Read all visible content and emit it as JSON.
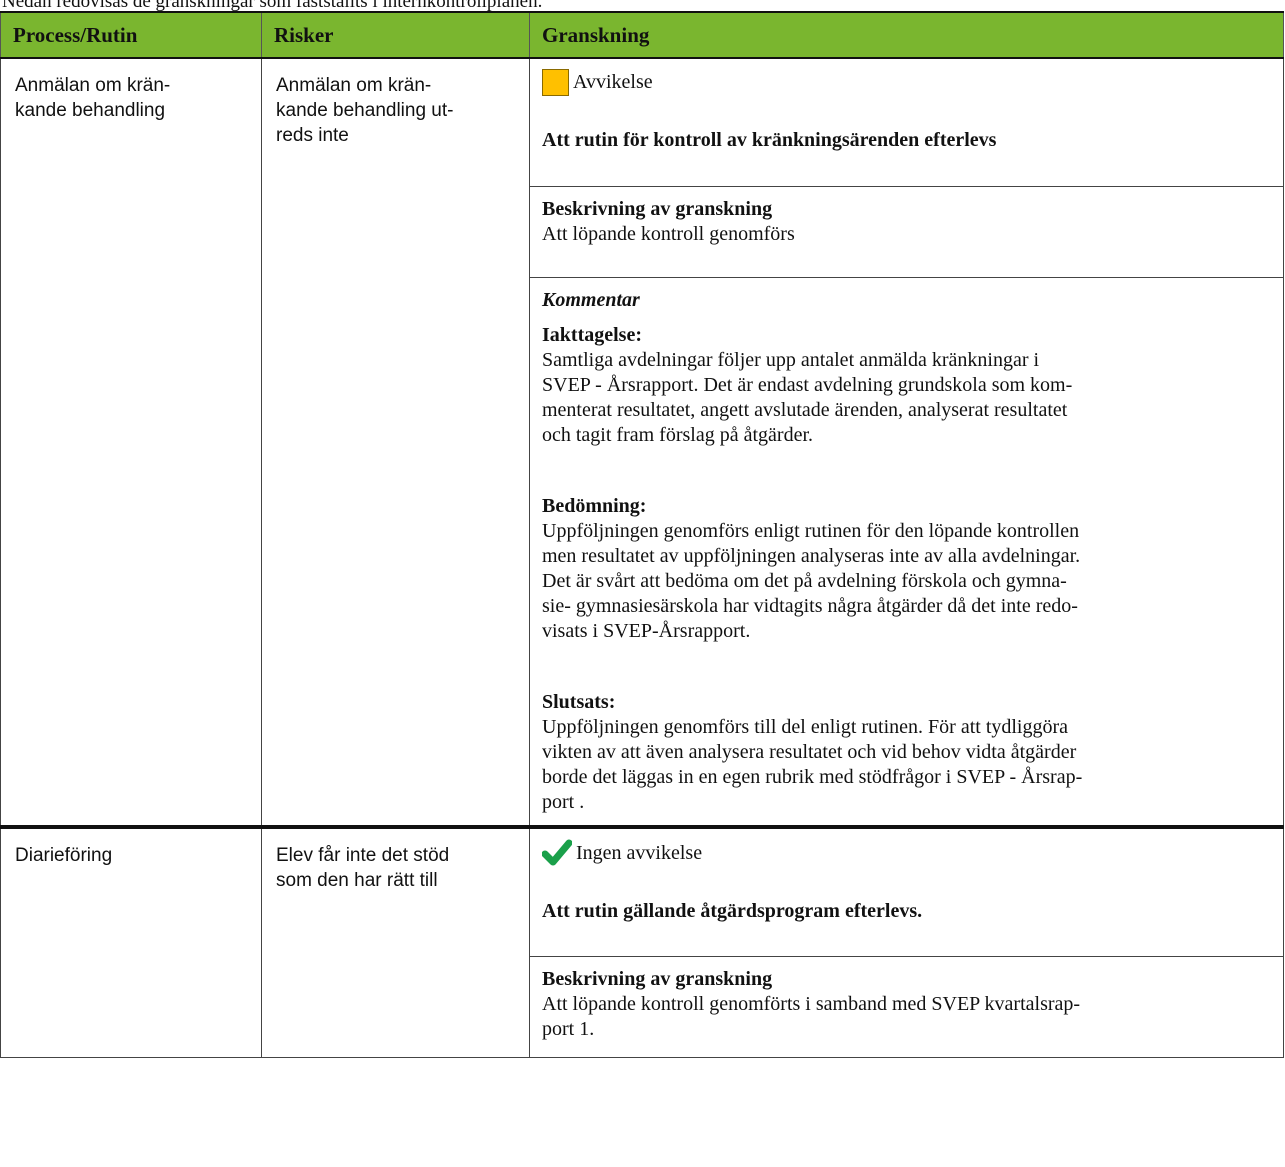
{
  "intro_text": "Nedan redovisas de granskningar som fastställts i internkontrollplanen.",
  "headers": {
    "process": "Process/Rutin",
    "risks": "Risker",
    "review": "Granskning"
  },
  "colors": {
    "header_green": "#7ab62f",
    "warning_yellow": "#ffc000",
    "ok_green": "#1aa04a"
  },
  "rows": [
    {
      "process_line1": "Anmälan om krän-",
      "process_line2": "kande behandling",
      "risk_line1": "Anmälan om krän-",
      "risk_line2": "kande behandling ut-",
      "risk_line3": "reds inte",
      "status_icon": "yellow-square-icon",
      "status": "Avvikelse",
      "objective": "Att rutin för kontroll av kränkningsärenden efterlevs",
      "desc_title": "Beskrivning av granskning",
      "desc_text": "Att löpande kontroll genomförs",
      "comment_title": "Kommentar",
      "obs_title": "Iakttagelse:",
      "obs_lines": [
        "Samtliga avdelningar följer upp antalet anmälda kränkningar i",
        "SVEP - Årsrapport. Det är endast avdelning grundskola som kom-",
        "menterat resultatet, angett avslutade ärenden, analyserat resultatet",
        "och tagit fram förslag på åtgärder."
      ],
      "assess_title": "Bedömning:",
      "assess_lines": [
        "Uppföljningen genomförs enligt rutinen för den löpande kontrollen",
        "men resultatet av uppföljningen analyseras inte av alla avdelningar.",
        "Det är svårt att bedöma om det på avdelning förskola och gymna-",
        "sie- gymnasiesärskola har vidtagits några åtgärder då det inte redo-",
        "visats i SVEP-Årsrapport."
      ],
      "concl_title": "Slutsats:",
      "concl_lines": [
        "Uppföljningen genomförs till del enligt rutinen. För att tydliggöra",
        "vikten av att även analysera resultatet och vid behov vidta åtgärder",
        "borde det läggas in en egen rubrik med stödfrågor i SVEP - Årsrap-",
        "port ."
      ]
    },
    {
      "process_line1": "Diarieföring",
      "risk_line1": "Elev får inte det stöd",
      "risk_line2": "som den har rätt till",
      "status_icon": "green-check-icon",
      "status": "Ingen avvikelse",
      "objective": "Att rutin gällande åtgärdsprogram efterlevs.",
      "desc_title": "Beskrivning av granskning",
      "desc_lines": [
        "Att löpande kontroll genomförts i samband med SVEP kvartalsrap-",
        "port 1."
      ]
    }
  ]
}
